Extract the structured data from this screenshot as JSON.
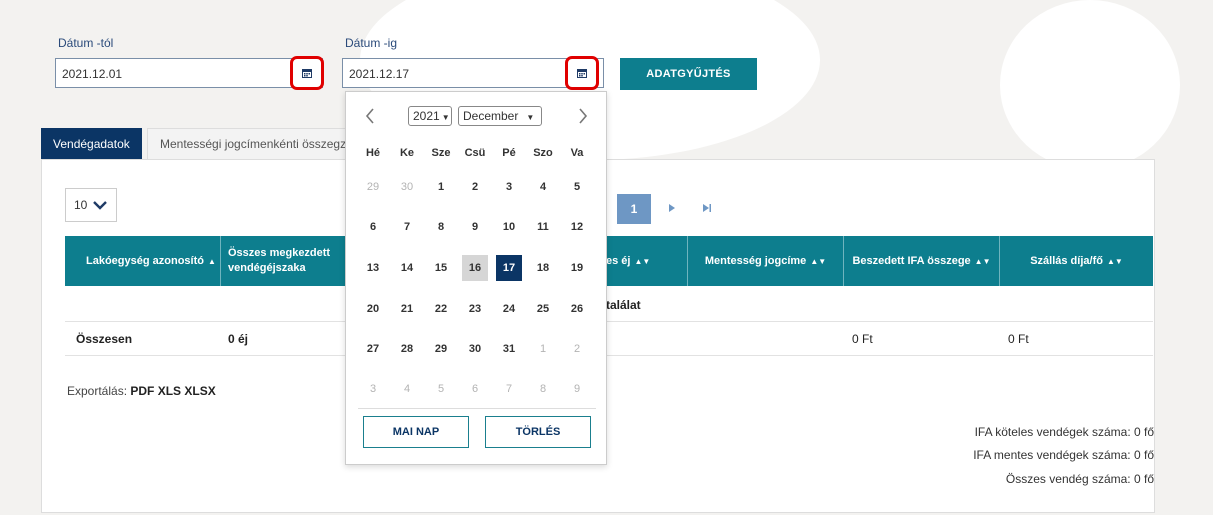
{
  "filters": {
    "from_label": "Dátum -tól",
    "from_value": "2021.12.01",
    "to_label": "Dátum -ig",
    "to_value": "2021.12.17",
    "collect_button": "ADATGYŰJTÉS"
  },
  "tabs": [
    {
      "label": "Vendégadatok"
    },
    {
      "label": "Mentességi jogcímenkénti összegz"
    }
  ],
  "page_size": "10",
  "pager": {
    "current": "1"
  },
  "table": {
    "headers": [
      "Lakóegység azonosító",
      "Összes megkezdett vendégéjszaka",
      "es éj",
      "Mentesség jogcíme",
      "Beszedett IFA összege",
      "Szállás díja/fő"
    ],
    "empty_text": "találat",
    "total_row": {
      "label": "Összesen",
      "nights": "0 éj",
      "ifa": "0 Ft",
      "fee": "0 Ft"
    }
  },
  "export": {
    "label": "Exportálás:",
    "formats": "PDF XLS XLSX"
  },
  "summary": {
    "ifa_taxable": "IFA köteles vendégek száma: 0 fő",
    "ifa_exempt": "IFA mentes vendégek száma: 0 fő",
    "total": "Összes vendég száma: 0 fő"
  },
  "calendar": {
    "year": "2021",
    "month": "December",
    "weekdays": [
      "Hé",
      "Ke",
      "Sze",
      "Csü",
      "Pé",
      "Szo",
      "Va"
    ],
    "weeks": [
      [
        "29",
        "30",
        "1",
        "2",
        "3",
        "4",
        "5"
      ],
      [
        "6",
        "7",
        "8",
        "9",
        "10",
        "11",
        "12"
      ],
      [
        "13",
        "14",
        "15",
        "16",
        "17",
        "18",
        "19"
      ],
      [
        "20",
        "21",
        "22",
        "23",
        "24",
        "25",
        "26"
      ],
      [
        "27",
        "28",
        "29",
        "30",
        "31",
        "1",
        "2"
      ],
      [
        "3",
        "4",
        "5",
        "6",
        "7",
        "8",
        "9"
      ]
    ],
    "today_button": "MAI NAP",
    "clear_button": "TÖRLÉS"
  },
  "colors": {
    "accent": "#0d7e8e",
    "navy": "#0b3565",
    "highlight_ring": "#e00000"
  }
}
